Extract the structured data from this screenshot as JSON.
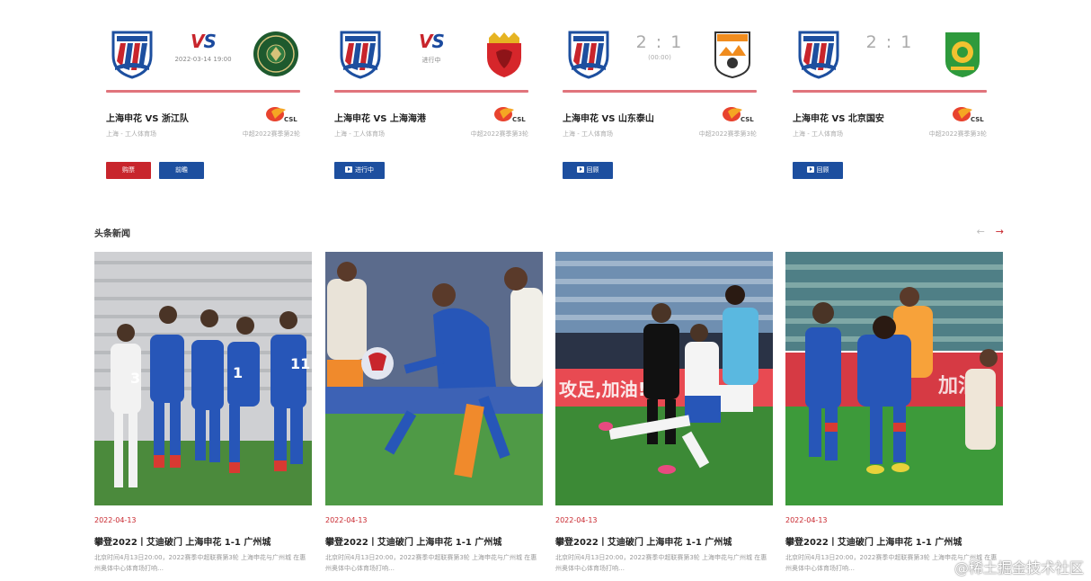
{
  "matches": [
    {
      "home_team": "上海申花",
      "away_team": "浙江队",
      "center_text": "VS",
      "center_sub": "2022-03-14  19:00",
      "title": "上海申花 VS 浙江队",
      "venue": "上海 - 工人体育场",
      "round": "中超2022赛季第2轮",
      "buttons": [
        "购票",
        "前瞻"
      ],
      "home_logo_icon": "shenhua-crest-icon",
      "away_logo_icon": "zhejiang-crest-icon"
    },
    {
      "home_team": "上海申花",
      "away_team": "上海海港",
      "center_text": "VS",
      "center_sub": "进行中",
      "title": "上海申花 VS 上海海港",
      "venue": "上海 - 工人体育场",
      "round": "中超2022赛季第3轮",
      "buttons": [
        "进行中"
      ],
      "home_logo_icon": "shenhua-crest-icon",
      "away_logo_icon": "haigang-crest-icon"
    },
    {
      "home_team": "上海申花",
      "away_team": "山东泰山",
      "center_text": "2 : 1",
      "center_sub": "(00:00)",
      "title": "上海申花 VS 山东泰山",
      "venue": "上海 - 工人体育场",
      "round": "中超2022赛季第3轮",
      "buttons": [
        "回顾"
      ],
      "home_logo_icon": "shenhua-crest-icon",
      "away_logo_icon": "taishan-crest-icon"
    },
    {
      "home_team": "上海申花",
      "away_team": "北京国安",
      "center_text": "2 : 1",
      "center_sub": "",
      "title": "上海申花 VS 北京国安",
      "venue": "上海 - 工人体育场",
      "round": "中超2022赛季第3轮",
      "buttons": [
        "回顾"
      ],
      "home_logo_icon": "shenhua-crest-icon",
      "away_logo_icon": "guoan-crest-icon"
    }
  ],
  "news": {
    "heading": "头条新闻",
    "prev_icon": "arrow-left-icon",
    "next_icon": "arrow-right-icon",
    "prev_glyph": "←",
    "next_glyph": "→",
    "items": [
      {
        "date": "2022-04-13",
        "headline": "攀登2022丨艾迪破门 上海申花 1-1 广州城",
        "summary": "北京时间4月13日20:00，2022赛季中超联赛第3轮 上海申花与广州城 在惠州奥体中心体育场打响…"
      },
      {
        "date": "2022-04-13",
        "headline": "攀登2022丨艾迪破门 上海申花 1-1 广州城",
        "summary": "北京时间4月13日20:00，2022赛季中超联赛第3轮 上海申花与广州城 在惠州奥体中心体育场打响…"
      },
      {
        "date": "2022-04-13",
        "headline": "攀登2022丨艾迪破门 上海申花 1-1 广州城",
        "summary": "北京时间4月13日20:00，2022赛季中超联赛第3轮 上海申花与广州城 在惠州奥体中心体育场打响…"
      },
      {
        "date": "2022-04-13",
        "headline": "攀登2022丨艾迪破门 上海申花 1-1 广州城",
        "summary": "北京时间4月13日20:00，2022赛季中超联赛第3轮 上海申花与广州城 在惠州奥体中心体育场打响…"
      }
    ]
  },
  "watermark": "@稀土掘金技术社区",
  "colors": {
    "accent_red": "#c8252c",
    "accent_blue": "#1d4f9f",
    "divider_pink": "#e0747c"
  }
}
